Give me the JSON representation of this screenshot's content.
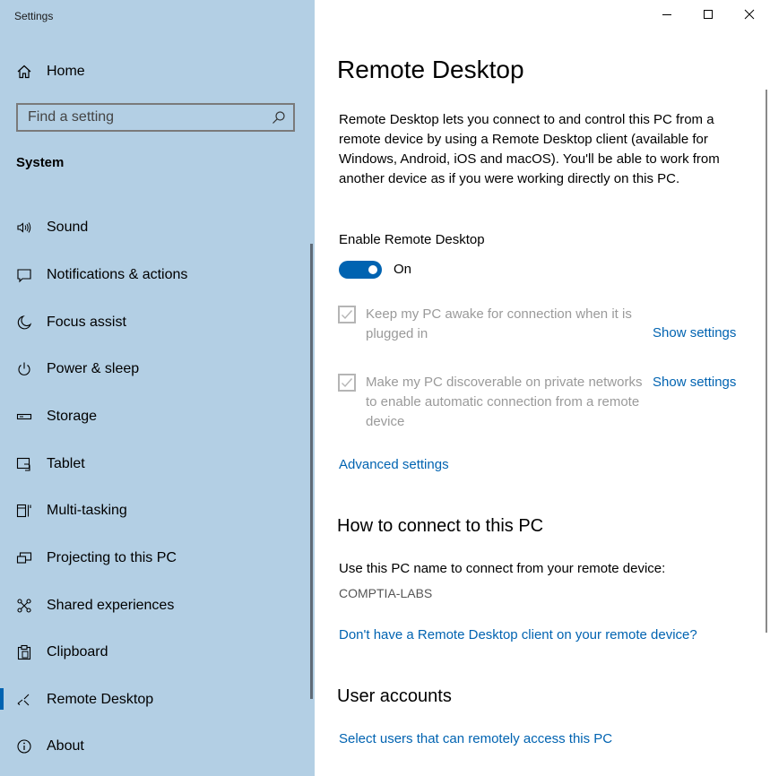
{
  "window": {
    "app_title": "Settings"
  },
  "sidebar": {
    "home_label": "Home",
    "search_placeholder": "Find a setting",
    "section_label": "System",
    "items": [
      {
        "label": "Sound",
        "icon": "speaker-icon"
      },
      {
        "label": "Notifications & actions",
        "icon": "notification-icon"
      },
      {
        "label": "Focus assist",
        "icon": "moon-icon"
      },
      {
        "label": "Power & sleep",
        "icon": "power-icon"
      },
      {
        "label": "Storage",
        "icon": "storage-icon"
      },
      {
        "label": "Tablet",
        "icon": "tablet-icon"
      },
      {
        "label": "Multi-tasking",
        "icon": "multitasking-icon"
      },
      {
        "label": "Projecting to this PC",
        "icon": "projecting-icon"
      },
      {
        "label": "Shared experiences",
        "icon": "shared-experiences-icon"
      },
      {
        "label": "Clipboard",
        "icon": "clipboard-icon"
      },
      {
        "label": "Remote Desktop",
        "icon": "remote-desktop-icon",
        "active": true
      },
      {
        "label": "About",
        "icon": "info-icon"
      }
    ]
  },
  "main": {
    "title": "Remote Desktop",
    "description": "Remote Desktop lets you connect to and control this PC from a remote device by using a Remote Desktop client (available for Windows, Android, iOS and macOS). You'll be able to work from another device as if you were working directly on this PC.",
    "enable_label": "Enable Remote Desktop",
    "toggle_state": "On",
    "toggle_on": true,
    "checkboxes": [
      {
        "label": "Keep my PC awake for connection when it is plugged in",
        "checked": true,
        "disabled": true,
        "link": "Show settings"
      },
      {
        "label": "Make my PC discoverable on private networks to enable automatic connection from a remote device",
        "checked": true,
        "disabled": true,
        "link": "Show settings"
      }
    ],
    "advanced_link": "Advanced settings",
    "connect_heading": "How to connect to this PC",
    "connect_text": "Use this PC name to connect from your remote device:",
    "pc_name": "COMPTIA-LABS",
    "client_link": "Don't have a Remote Desktop client on your remote device?",
    "accounts_heading": "User accounts",
    "accounts_link": "Select users that can remotely access this PC"
  },
  "colors": {
    "sidebar_bg": "#b3cfe4",
    "accent": "#0063b1",
    "disabled_text": "#9a9a9a"
  }
}
